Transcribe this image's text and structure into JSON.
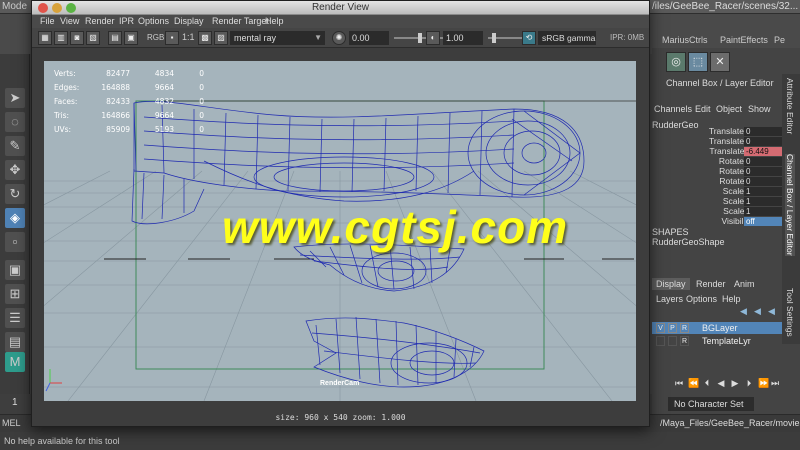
{
  "maya": {
    "mode_label": "Mode",
    "project_path": "/iles/GeeBee_Racer/scenes/32...",
    "shelf_tabs": [
      "MariusCtrls",
      "PaintEffects",
      "Pe"
    ],
    "shelf_icons": [
      "torus-icon",
      "cube-axis-icon",
      "cross-lines-icon"
    ],
    "channel_box_title": "Channel Box / Layer Editor",
    "channel_menus": [
      "Channels",
      "Edit",
      "Object",
      "Show"
    ],
    "selected_object": "RudderGeo",
    "attributes": [
      {
        "label": "Translate X",
        "value": "0"
      },
      {
        "label": "Translate Y",
        "value": "0"
      },
      {
        "label": "Translate Z",
        "value": "-6.449"
      },
      {
        "label": "Rotate X",
        "value": "0"
      },
      {
        "label": "Rotate Y",
        "value": "0"
      },
      {
        "label": "Rotate Z",
        "value": "0"
      },
      {
        "label": "Scale X",
        "value": "1"
      },
      {
        "label": "Scale Y",
        "value": "1"
      },
      {
        "label": "Scale Z",
        "value": "1"
      },
      {
        "label": "Visibility",
        "value": "off"
      }
    ],
    "shapes_title": "SHAPES",
    "shape_name": "RudderGeoShape",
    "side_tabs": [
      "Attribute Editor",
      "Channel Box / Layer Editor",
      "Tool Settings"
    ],
    "layer_tabs": [
      "Display",
      "Render",
      "Anim"
    ],
    "layer_menus": [
      "Layers",
      "Options",
      "Help"
    ],
    "layers": [
      {
        "flags": [
          "V",
          "P",
          "R"
        ],
        "name": "BGLayer"
      },
      {
        "flags": [
          "",
          "",
          "R"
        ],
        "name": "TemplateLyr"
      }
    ],
    "playback_buttons": [
      "⏮",
      "⏪",
      "⏴",
      "◀",
      "▶",
      "⏵",
      "⏩",
      "⏭"
    ],
    "frame": "1",
    "character_set": "No Character Set",
    "mel_label": "MEL",
    "movies_path": "/Maya_Files/GeeBee_Racer/movies/",
    "help_text": "No help available for this tool"
  },
  "render_view": {
    "title": "Render View",
    "menus": [
      "File",
      "View",
      "Render",
      "IPR",
      "Options",
      "Display",
      "Render Target",
      "Help"
    ],
    "toolbar": {
      "rgb_label": "RGB",
      "ratio_label": "1:1",
      "renderer": "mental ray",
      "exposure": "0.00",
      "gamma": "1.00",
      "color_space": "sRGB gamma",
      "ipr_memory": "IPR: 0MB"
    },
    "hud": [
      {
        "label": "Verts:",
        "v1": "82477",
        "v2": "4834",
        "v3": "0"
      },
      {
        "label": "Edges:",
        "v1": "164888",
        "v2": "9664",
        "v3": "0"
      },
      {
        "label": "Faces:",
        "v1": "82433",
        "v2": "4832",
        "v3": "0"
      },
      {
        "label": "Tris:",
        "v1": "164866",
        "v2": "9664",
        "v3": "0"
      },
      {
        "label": "UVs:",
        "v1": "85909",
        "v2": "5193",
        "v3": "0"
      }
    ],
    "camera": "RenderCam",
    "status": "size: 960 x 540 zoom: 1.000"
  },
  "watermark": "www.cgtsj.com",
  "colors": {
    "viewport_bg": "#a5b4bc",
    "wireframe": "#1f2ab0",
    "highlight_attr": "#d46b72",
    "selection": "#5285b8",
    "watermark": "#ffff1a"
  }
}
